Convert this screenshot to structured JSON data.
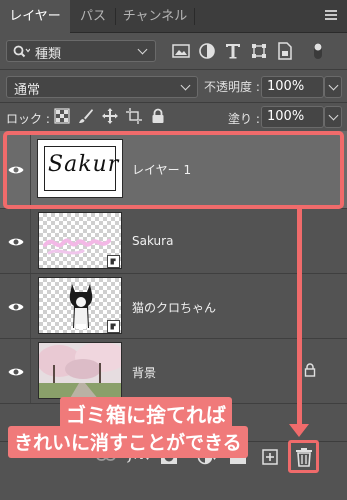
{
  "tabs": [
    {
      "label": "レイヤー",
      "active": true
    },
    {
      "label": "パス",
      "active": false
    },
    {
      "label": "チャンネル",
      "active": false
    }
  ],
  "panel_menu_icon": "hamburger-menu-icon",
  "filter": {
    "search_icon": "search-icon",
    "kind_label": "種類",
    "filter_icons": [
      "image-filter-icon",
      "adjustment-filter-icon",
      "text-filter-icon",
      "shape-filter-icon",
      "smart-object-filter-icon",
      "filter-toggle-icon"
    ]
  },
  "blend": {
    "mode": "通常",
    "opacity_label": "不透明度 :",
    "opacity_value": "100%"
  },
  "lock": {
    "label": "ロック :",
    "icons": [
      "lock-transparent-pixels-icon",
      "lock-image-pixels-icon",
      "lock-position-icon",
      "lock-artboard-icon",
      "lock-all-icon"
    ],
    "fill_label": "塗り :",
    "fill_value": "100%"
  },
  "layers": [
    {
      "name": "レイヤー 1",
      "visible": true,
      "selected": true,
      "thumb_text": "Sakura"
    },
    {
      "name": "Sakura",
      "visible": true,
      "selected": false,
      "smart_object": true
    },
    {
      "name": "猫のクロちゃん",
      "visible": true,
      "selected": false,
      "smart_object": true
    },
    {
      "name": "背景",
      "visible": true,
      "selected": false,
      "locked": true
    }
  ],
  "bottom_icons": [
    "link-layers-icon",
    "fx-icon",
    "layer-mask-icon",
    "adjustment-layer-icon",
    "new-group-icon",
    "new-layer-icon",
    "trash-icon"
  ],
  "bottom_fx_label": "fx",
  "annotation": {
    "line1": "ゴミ箱に捨てれば",
    "line2": "きれいに消すことができる",
    "color": "#f06b6b"
  }
}
